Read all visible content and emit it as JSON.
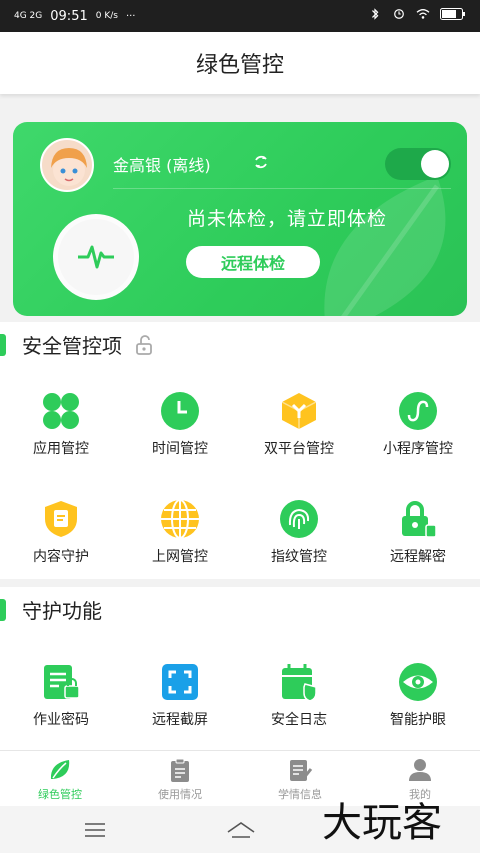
{
  "statusbar": {
    "carrier": "4G 2G",
    "time": "09:51",
    "net_speed": "0 K/s"
  },
  "header": {
    "title": "绿色管控"
  },
  "card": {
    "user": "金高银 (离线)",
    "check_text": "尚未体检，请立即体检",
    "button_label": "远程体检",
    "toggle_on": true
  },
  "security": {
    "title": "安全管控项",
    "items": [
      {
        "label": "应用管控",
        "icon": "apps-grid-icon",
        "color": "#2ecc5a"
      },
      {
        "label": "时间管控",
        "icon": "clock-icon",
        "color": "#2ecc5a"
      },
      {
        "label": "双平台管控",
        "icon": "cube-icon",
        "color": "#ffc31f"
      },
      {
        "label": "小程序管控",
        "icon": "mini-program-icon",
        "color": "#2ecc5a"
      },
      {
        "label": "内容守护",
        "icon": "shield-icon",
        "color": "#ffc31f"
      },
      {
        "label": "上网管控",
        "icon": "globe-icon",
        "color": "#ffc31f"
      },
      {
        "label": "指纹管控",
        "icon": "fingerprint-icon",
        "color": "#2ecc5a"
      },
      {
        "label": "远程解密",
        "icon": "unlock-icon",
        "color": "#2ecc5a"
      }
    ]
  },
  "guard": {
    "title": "守护功能",
    "items": [
      {
        "label": "作业密码",
        "icon": "homework-lock-icon",
        "color": "#2ecc5a"
      },
      {
        "label": "远程截屏",
        "icon": "screenshot-icon",
        "color": "#1aa0e8"
      },
      {
        "label": "安全日志",
        "icon": "calendar-shield-icon",
        "color": "#2ecc5a"
      },
      {
        "label": "智能护眼",
        "icon": "eye-icon",
        "color": "#2ecc5a"
      }
    ]
  },
  "bottomnav": {
    "items": [
      {
        "label": "绿色管控",
        "icon": "leaf-icon",
        "active": true
      },
      {
        "label": "使用情况",
        "icon": "clipboard-icon",
        "active": false
      },
      {
        "label": "学情信息",
        "icon": "notes-icon",
        "active": false
      },
      {
        "label": "我的",
        "icon": "person-icon",
        "active": false
      }
    ]
  },
  "watermark": "大玩客"
}
